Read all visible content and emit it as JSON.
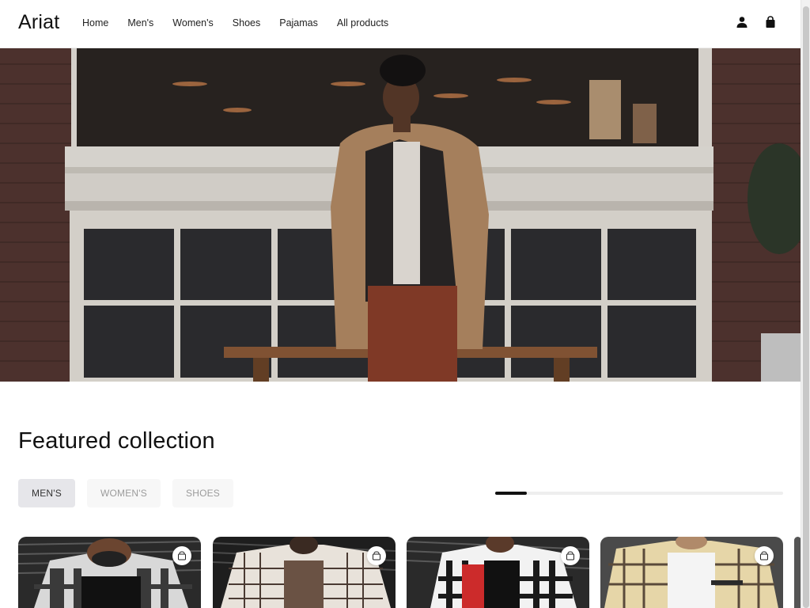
{
  "header": {
    "logo": "Ariat",
    "nav": [
      "Home",
      "Men's",
      "Women's",
      "Shoes",
      "Pajamas",
      "All products"
    ],
    "icons": [
      "user-icon",
      "shopping-bag-icon"
    ]
  },
  "hero": {
    "image_alt": "man in camel duffle coat standing in front of a shop window"
  },
  "featured": {
    "title": "Featured collection",
    "tabs": [
      "MEN'S",
      "WOMEN'S",
      "SHOES"
    ],
    "active_tab": "MEN'S",
    "carousel_progress": 0.11
  },
  "products": [
    {
      "icon": "cart-icon"
    },
    {
      "icon": "cart-icon"
    },
    {
      "icon": "cart-icon"
    },
    {
      "icon": "cart-icon"
    }
  ],
  "colors": {
    "accent": "#111111",
    "tab_active_bg": "#e6e6ea",
    "tab_bg": "#f7f7f7"
  }
}
